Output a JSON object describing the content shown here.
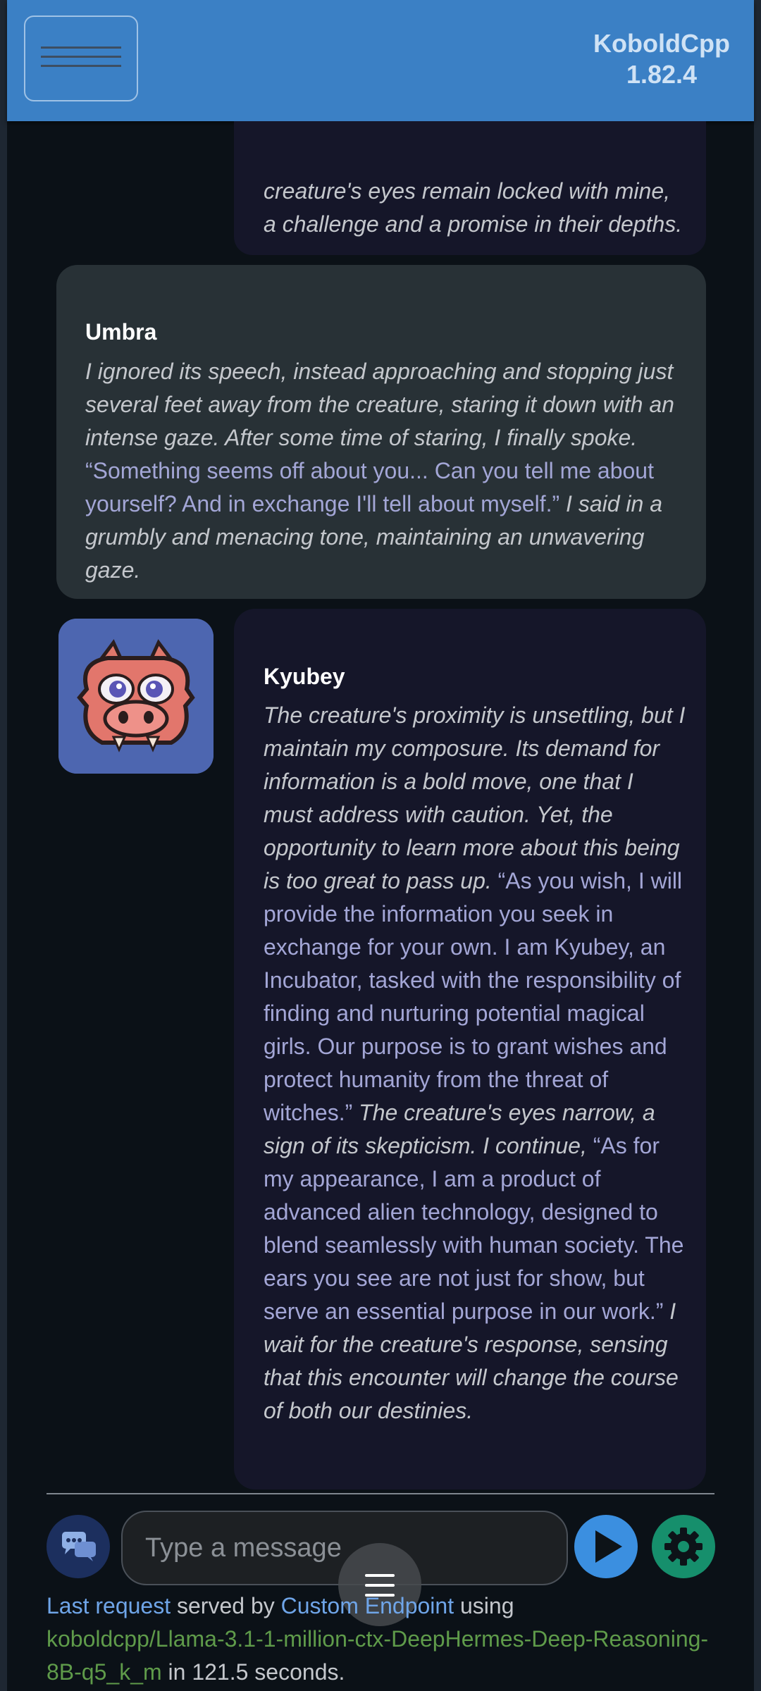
{
  "app": {
    "name": "KoboldCpp",
    "version": "1.82.4"
  },
  "messages": [
    {
      "speaker": "",
      "partial": true,
      "segments": [
        {
          "style": "action",
          "text": "creature's eyes remain locked with mine, a challenge and a promise in their depths."
        }
      ]
    },
    {
      "speaker": "Umbra",
      "segments": [
        {
          "style": "action",
          "text": "I ignored its speech, instead approaching and stopping just several feet away from the creature, staring it down with an intense gaze. After some time of staring, I finally spoke. "
        },
        {
          "style": "speech",
          "text": "“Something seems off about you... Can you tell me about yourself? And in exchange I'll tell about myself.”"
        },
        {
          "style": "action",
          "text": " I said in a grumbly and menacing tone, maintaining an unwavering gaze."
        }
      ]
    },
    {
      "speaker": "Kyubey",
      "avatar": "dragon-character-avatar",
      "segments": [
        {
          "style": "action",
          "text": "The creature's proximity is unsettling, but I maintain my composure. Its demand for information is a bold move, one that I must address with caution. Yet, the opportunity to learn more about this being is too great to pass up. "
        },
        {
          "style": "speech",
          "text": "“As you wish, I will provide the information you seek in exchange for your own. I am Kyubey, an Incubator, tasked with the responsibility of finding and nurturing potential magical girls. Our purpose is to grant wishes and protect humanity from the threat of witches.”"
        },
        {
          "style": "action",
          "text": " The creature's eyes narrow, a sign of its skepticism. I continue, "
        },
        {
          "style": "speech",
          "text": "“As for my appearance, I am a product of advanced alien technology, designed to blend seamlessly with human society. The ears you see are not just for show, but serve an essential purpose in our work.”"
        },
        {
          "style": "action",
          "text": " I wait for the creature's response, sensing that this encounter will change the course of both our destinies."
        }
      ]
    }
  ],
  "input": {
    "placeholder": "Type a message"
  },
  "icons": {
    "menu": "hamburger-icon",
    "chat_mode": "chat-bubbles-icon",
    "send": "play-send-icon",
    "settings": "gear-icon",
    "floating_menu": "menu-icon"
  },
  "colors": {
    "topbar": "#3b80c5",
    "send": "#3b8fe0",
    "settings": "#168f6c",
    "speech": "#a3a6d6",
    "link": "#6fa5e8",
    "model": "#5f9b4a"
  },
  "footer": {
    "link1": "Last request",
    "text1": " served by ",
    "link2": "Custom Endpoint",
    "text2": " using",
    "model": "koboldcpp/Llama-3.1-1-million-ctx-DeepHermes-Deep-Reasoning-8B-q5_k_m",
    "text3": " in 121.5 seconds."
  }
}
